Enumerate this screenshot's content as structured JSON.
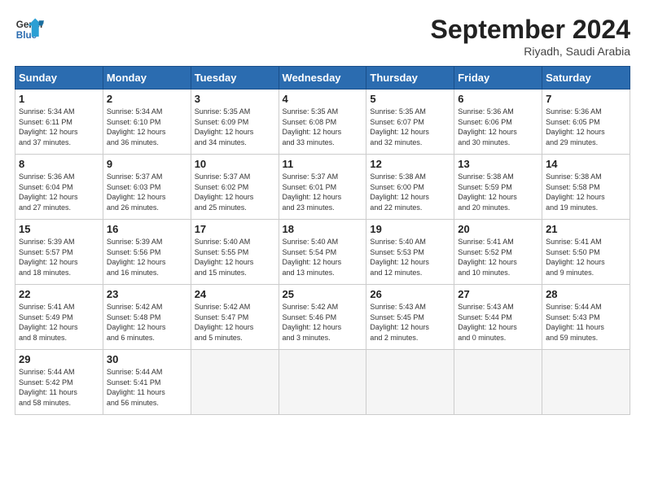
{
  "header": {
    "logo_line1": "General",
    "logo_line2": "Blue",
    "month": "September 2024",
    "location": "Riyadh, Saudi Arabia"
  },
  "weekdays": [
    "Sunday",
    "Monday",
    "Tuesday",
    "Wednesday",
    "Thursday",
    "Friday",
    "Saturday"
  ],
  "weeks": [
    [
      {
        "num": "1",
        "info": "Sunrise: 5:34 AM\nSunset: 6:11 PM\nDaylight: 12 hours\nand 37 minutes."
      },
      {
        "num": "2",
        "info": "Sunrise: 5:34 AM\nSunset: 6:10 PM\nDaylight: 12 hours\nand 36 minutes."
      },
      {
        "num": "3",
        "info": "Sunrise: 5:35 AM\nSunset: 6:09 PM\nDaylight: 12 hours\nand 34 minutes."
      },
      {
        "num": "4",
        "info": "Sunrise: 5:35 AM\nSunset: 6:08 PM\nDaylight: 12 hours\nand 33 minutes."
      },
      {
        "num": "5",
        "info": "Sunrise: 5:35 AM\nSunset: 6:07 PM\nDaylight: 12 hours\nand 32 minutes."
      },
      {
        "num": "6",
        "info": "Sunrise: 5:36 AM\nSunset: 6:06 PM\nDaylight: 12 hours\nand 30 minutes."
      },
      {
        "num": "7",
        "info": "Sunrise: 5:36 AM\nSunset: 6:05 PM\nDaylight: 12 hours\nand 29 minutes."
      }
    ],
    [
      {
        "num": "8",
        "info": "Sunrise: 5:36 AM\nSunset: 6:04 PM\nDaylight: 12 hours\nand 27 minutes."
      },
      {
        "num": "9",
        "info": "Sunrise: 5:37 AM\nSunset: 6:03 PM\nDaylight: 12 hours\nand 26 minutes."
      },
      {
        "num": "10",
        "info": "Sunrise: 5:37 AM\nSunset: 6:02 PM\nDaylight: 12 hours\nand 25 minutes."
      },
      {
        "num": "11",
        "info": "Sunrise: 5:37 AM\nSunset: 6:01 PM\nDaylight: 12 hours\nand 23 minutes."
      },
      {
        "num": "12",
        "info": "Sunrise: 5:38 AM\nSunset: 6:00 PM\nDaylight: 12 hours\nand 22 minutes."
      },
      {
        "num": "13",
        "info": "Sunrise: 5:38 AM\nSunset: 5:59 PM\nDaylight: 12 hours\nand 20 minutes."
      },
      {
        "num": "14",
        "info": "Sunrise: 5:38 AM\nSunset: 5:58 PM\nDaylight: 12 hours\nand 19 minutes."
      }
    ],
    [
      {
        "num": "15",
        "info": "Sunrise: 5:39 AM\nSunset: 5:57 PM\nDaylight: 12 hours\nand 18 minutes."
      },
      {
        "num": "16",
        "info": "Sunrise: 5:39 AM\nSunset: 5:56 PM\nDaylight: 12 hours\nand 16 minutes."
      },
      {
        "num": "17",
        "info": "Sunrise: 5:40 AM\nSunset: 5:55 PM\nDaylight: 12 hours\nand 15 minutes."
      },
      {
        "num": "18",
        "info": "Sunrise: 5:40 AM\nSunset: 5:54 PM\nDaylight: 12 hours\nand 13 minutes."
      },
      {
        "num": "19",
        "info": "Sunrise: 5:40 AM\nSunset: 5:53 PM\nDaylight: 12 hours\nand 12 minutes."
      },
      {
        "num": "20",
        "info": "Sunrise: 5:41 AM\nSunset: 5:52 PM\nDaylight: 12 hours\nand 10 minutes."
      },
      {
        "num": "21",
        "info": "Sunrise: 5:41 AM\nSunset: 5:50 PM\nDaylight: 12 hours\nand 9 minutes."
      }
    ],
    [
      {
        "num": "22",
        "info": "Sunrise: 5:41 AM\nSunset: 5:49 PM\nDaylight: 12 hours\nand 8 minutes."
      },
      {
        "num": "23",
        "info": "Sunrise: 5:42 AM\nSunset: 5:48 PM\nDaylight: 12 hours\nand 6 minutes."
      },
      {
        "num": "24",
        "info": "Sunrise: 5:42 AM\nSunset: 5:47 PM\nDaylight: 12 hours\nand 5 minutes."
      },
      {
        "num": "25",
        "info": "Sunrise: 5:42 AM\nSunset: 5:46 PM\nDaylight: 12 hours\nand 3 minutes."
      },
      {
        "num": "26",
        "info": "Sunrise: 5:43 AM\nSunset: 5:45 PM\nDaylight: 12 hours\nand 2 minutes."
      },
      {
        "num": "27",
        "info": "Sunrise: 5:43 AM\nSunset: 5:44 PM\nDaylight: 12 hours\nand 0 minutes."
      },
      {
        "num": "28",
        "info": "Sunrise: 5:44 AM\nSunset: 5:43 PM\nDaylight: 11 hours\nand 59 minutes."
      }
    ],
    [
      {
        "num": "29",
        "info": "Sunrise: 5:44 AM\nSunset: 5:42 PM\nDaylight: 11 hours\nand 58 minutes."
      },
      {
        "num": "30",
        "info": "Sunrise: 5:44 AM\nSunset: 5:41 PM\nDaylight: 11 hours\nand 56 minutes."
      },
      {
        "num": "",
        "info": ""
      },
      {
        "num": "",
        "info": ""
      },
      {
        "num": "",
        "info": ""
      },
      {
        "num": "",
        "info": ""
      },
      {
        "num": "",
        "info": ""
      }
    ]
  ]
}
